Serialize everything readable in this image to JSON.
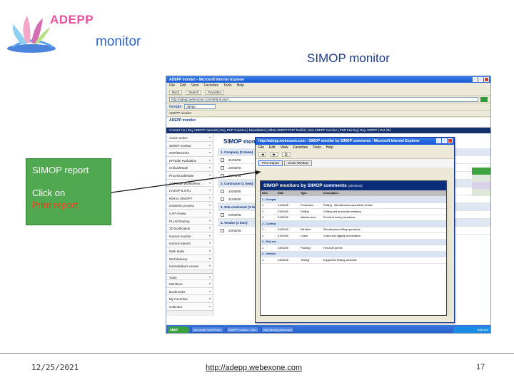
{
  "slide": {
    "logo_text": "ADEPP",
    "logo_word": "monitor",
    "title": "SIMOP monitor",
    "callout": {
      "title": "SIMOP report",
      "line1": "Click on",
      "line2": "Print report"
    },
    "footer": {
      "date": "12/25/2021",
      "url": "http://adepp.webexone.com",
      "page": "17"
    }
  },
  "browser": {
    "title": "ADEPP monitor - Microsoft Internet Explorer",
    "menu": [
      "File",
      "Edit",
      "View",
      "Favorites",
      "Tools",
      "Help"
    ],
    "toolbar": [
      "Back",
      "Search",
      "Favorites"
    ],
    "address": "http://adepp.webexone.com/default.asp?...",
    "google_label": "Google",
    "search_value": "adepp",
    "links": "ADEPP monitor",
    "page_header": "ADEPP monitor",
    "nav": "Contact Us | Buy ADEPP manuals | Buy PHP Courses | Newsletters | What ADEPP PHP Toolkit | How ADEPP monitor | PHP training | Buy ADEPP | Get info",
    "sidebar": [
      "Action notice",
      "SIMOP monitor",
      "SOP/Desevks",
      "HF/Safe evaluation",
      "Critical/Mode",
      "Procedural/Mode",
      "AntPhase worksheets",
      "HAZOP & OTU",
      "Risk to SIMOPY",
      "Incidents process",
      "CAP review",
      "PLUS/Sharing",
      "3D Notification",
      "Hazard monitor",
      "Hazard reports",
      "Multi tasks",
      "Well delivery",
      "Hazard/alarm review",
      "Tools",
      "Members",
      "Bookmarks",
      "My Favorites",
      "Calendar"
    ],
    "main_title": "SIMOP monitor",
    "main_rows": [
      {
        "type": "grp",
        "text": "1. Company (2 items)"
      },
      {
        "type": "row",
        "text": "31/05/08"
      },
      {
        "type": "row",
        "text": "23/05/08"
      },
      {
        "type": "row",
        "text": "24/05/08"
      },
      {
        "type": "grp",
        "text": "2. Contractor (1 item)"
      },
      {
        "type": "row",
        "text": "24/05/08"
      },
      {
        "type": "row",
        "text": "31/05/08"
      },
      {
        "type": "grp",
        "text": "3. Sub-contractor (3 items)"
      },
      {
        "type": "row",
        "text": "23/05/08"
      },
      {
        "type": "grp",
        "text": "4. Vendor (1 item)"
      },
      {
        "type": "row",
        "text": "24/05/08"
      }
    ],
    "taskbar": {
      "start": "start",
      "tasks": [
        "Microsoft PowerPoint",
        "ADEPP monitor - Mic...",
        "http://adepp.webexone"
      ],
      "tray": "Internet"
    }
  },
  "popup": {
    "title": "http://adepp.webexone.com - SIMOP monitor by SIMOP comments - Microsoft Internet Explorer",
    "menu": [
      "File",
      "Edit",
      "View",
      "Favorites",
      "Tools",
      "Help"
    ],
    "buttons": [
      "Print Report",
      "Close Window"
    ],
    "report_title": "SIMOP monitors by SIMOP comments",
    "report_date": "(25 items)",
    "columns": [
      "Item",
      "Date",
      "Type",
      "Description"
    ],
    "rows": [
      {
        "type": "grp",
        "c1": "1 - Company (2 items)",
        "c2": "",
        "c3": "",
        "c4": ""
      },
      {
        "type": "row",
        "c1": "1",
        "c2": "31/05/08",
        "c3": "Production",
        "c4": "Drilling - Simultaneous operations review"
      },
      {
        "type": "row",
        "c1": "2",
        "c2": "23/05/08",
        "c3": "Drilling",
        "c4": "Drilling and production interface"
      },
      {
        "type": "row",
        "c1": "3",
        "c2": "24/05/08",
        "c3": "Maintenance",
        "c4": "Permit to work procedures"
      },
      {
        "type": "grp",
        "c1": "2 - Contractor (1 item)",
        "c2": "",
        "c3": "",
        "c4": ""
      },
      {
        "type": "row",
        "c1": "1",
        "c2": "24/05/08",
        "c3": "Wireline",
        "c4": "Simultaneous lifting operations"
      },
      {
        "type": "row",
        "c1": "2",
        "c2": "31/05/08",
        "c3": "Crane",
        "c4": "Crane and rigging coordination"
      },
      {
        "type": "grp",
        "c1": "3 - Sub-contractor (3 items)",
        "c2": "",
        "c3": "",
        "c4": ""
      },
      {
        "type": "row",
        "c1": "1",
        "c2": "23/05/08",
        "c3": "Painting",
        "c4": "Hot work permit"
      },
      {
        "type": "grp",
        "c1": "4 - Vendor (1 item)",
        "c2": "",
        "c3": "",
        "c4": ""
      },
      {
        "type": "row",
        "c1": "1",
        "c2": "24/05/08",
        "c3": "Testing",
        "c4": "Equipment testing schedule"
      }
    ]
  },
  "colors": {
    "callout_bg": "#50a950",
    "callout_highlight": "#f04020",
    "title_blue": "#1f3d8c",
    "report_header": "#0a2d7a"
  }
}
